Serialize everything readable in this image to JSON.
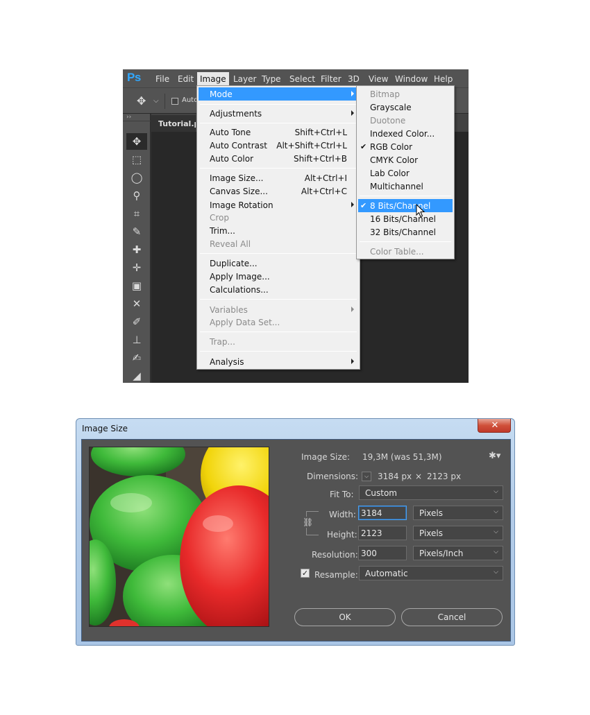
{
  "app": {
    "logo": "Ps",
    "menubar": [
      "File",
      "Edit",
      "Image",
      "Layer",
      "Type",
      "Select",
      "Filter",
      "3D",
      "View",
      "Window",
      "Help"
    ],
    "options_auto_label": "Auto",
    "document_tab": "Tutorial.psd",
    "accent_color": "#3399ff"
  },
  "image_menu": {
    "items": [
      {
        "label": "Mode",
        "shortcut": "",
        "submenu": true,
        "disabled": false
      },
      {
        "label": "Adjustments",
        "shortcut": "",
        "submenu": true,
        "disabled": false
      },
      {
        "label": "Auto Tone",
        "shortcut": "Shift+Ctrl+L",
        "submenu": false,
        "disabled": false
      },
      {
        "label": "Auto Contrast",
        "shortcut": "Alt+Shift+Ctrl+L",
        "submenu": false,
        "disabled": false
      },
      {
        "label": "Auto Color",
        "shortcut": "Shift+Ctrl+B",
        "submenu": false,
        "disabled": false
      },
      {
        "label": "Image Size...",
        "shortcut": "Alt+Ctrl+I",
        "submenu": false,
        "disabled": false
      },
      {
        "label": "Canvas Size...",
        "shortcut": "Alt+Ctrl+C",
        "submenu": false,
        "disabled": false
      },
      {
        "label": "Image Rotation",
        "shortcut": "",
        "submenu": true,
        "disabled": false
      },
      {
        "label": "Crop",
        "shortcut": "",
        "submenu": false,
        "disabled": true
      },
      {
        "label": "Trim...",
        "shortcut": "",
        "submenu": false,
        "disabled": false
      },
      {
        "label": "Reveal All",
        "shortcut": "",
        "submenu": false,
        "disabled": true
      },
      {
        "label": "Duplicate...",
        "shortcut": "",
        "submenu": false,
        "disabled": false
      },
      {
        "label": "Apply Image...",
        "shortcut": "",
        "submenu": false,
        "disabled": false
      },
      {
        "label": "Calculations...",
        "shortcut": "",
        "submenu": false,
        "disabled": false
      },
      {
        "label": "Variables",
        "shortcut": "",
        "submenu": true,
        "disabled": true
      },
      {
        "label": "Apply Data Set...",
        "shortcut": "",
        "submenu": false,
        "disabled": true
      },
      {
        "label": "Trap...",
        "shortcut": "",
        "submenu": false,
        "disabled": true
      },
      {
        "label": "Analysis",
        "shortcut": "",
        "submenu": true,
        "disabled": false
      }
    ]
  },
  "mode_submenu": {
    "items": [
      {
        "label": "Bitmap",
        "checked": false,
        "disabled": true
      },
      {
        "label": "Grayscale",
        "checked": false,
        "disabled": false
      },
      {
        "label": "Duotone",
        "checked": false,
        "disabled": true
      },
      {
        "label": "Indexed Color...",
        "checked": false,
        "disabled": false
      },
      {
        "label": "RGB Color",
        "checked": true,
        "disabled": false
      },
      {
        "label": "CMYK Color",
        "checked": false,
        "disabled": false
      },
      {
        "label": "Lab Color",
        "checked": false,
        "disabled": false
      },
      {
        "label": "Multichannel",
        "checked": false,
        "disabled": false
      },
      {
        "label": "8 Bits/Channel",
        "checked": true,
        "disabled": false
      },
      {
        "label": "16 Bits/Channel",
        "checked": false,
        "disabled": false
      },
      {
        "label": "32 Bits/Channel",
        "checked": false,
        "disabled": false
      },
      {
        "label": "Color Table...",
        "checked": false,
        "disabled": true
      }
    ],
    "checkmark": "✔"
  },
  "image_size_dialog": {
    "title": "Image Size",
    "close_glyph": "✕",
    "image_size_label": "Image Size:",
    "image_size_value": "19,3M (was 51,3M)",
    "dimensions_label": "Dimensions:",
    "dimensions_width": "3184 px",
    "dimensions_times": "×",
    "dimensions_height": "2123 px",
    "fit_to_label": "Fit To:",
    "fit_to_value": "Custom",
    "width_label": "Width:",
    "width_value": "3184",
    "width_unit": "Pixels",
    "height_label": "Height:",
    "height_value": "2123",
    "height_unit": "Pixels",
    "resolution_label": "Resolution:",
    "resolution_value": "300",
    "resolution_unit": "Pixels/Inch",
    "resample_label": "Resample:",
    "resample_checked": true,
    "resample_value": "Automatic",
    "ok_label": "OK",
    "cancel_label": "Cancel"
  }
}
